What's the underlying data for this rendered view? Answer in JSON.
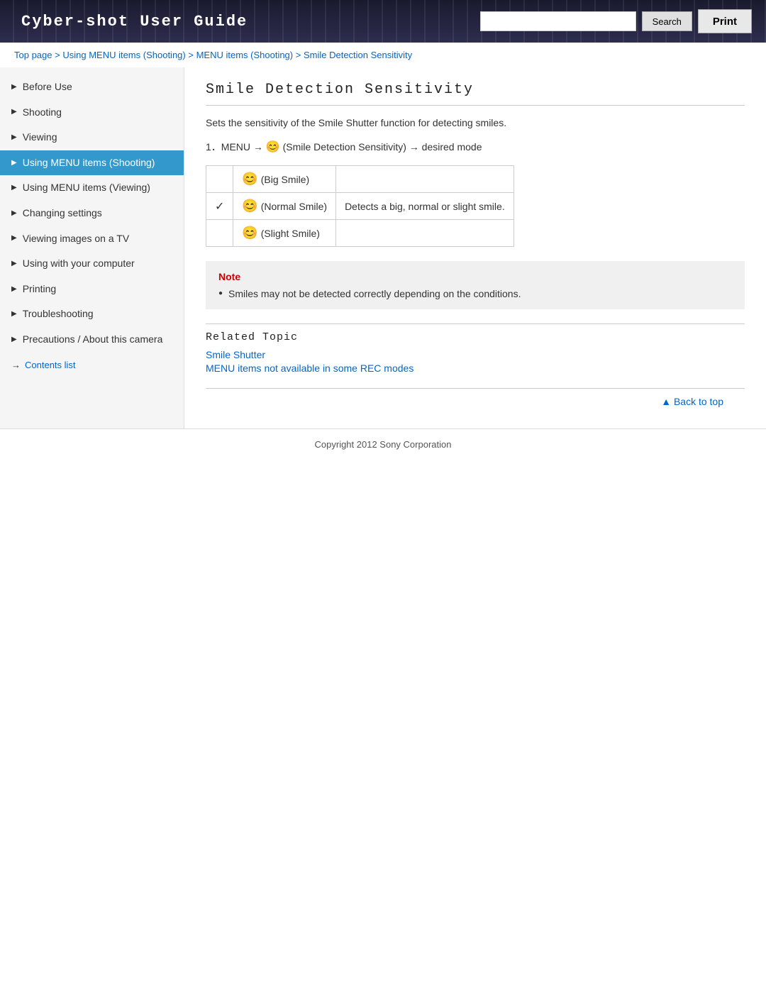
{
  "header": {
    "title": "Cyber-shot User Guide",
    "search_placeholder": "",
    "search_button_label": "Search",
    "print_button_label": "Print"
  },
  "breadcrumb": {
    "items": [
      {
        "label": "Top page",
        "href": "#"
      },
      {
        "label": "Using MENU items (Shooting)",
        "href": "#"
      },
      {
        "label": "MENU items (Shooting)",
        "href": "#"
      },
      {
        "label": "Smile Detection Sensitivity",
        "href": "#"
      }
    ],
    "separator": " > "
  },
  "sidebar": {
    "items": [
      {
        "label": "Before Use",
        "active": false
      },
      {
        "label": "Shooting",
        "active": false
      },
      {
        "label": "Viewing",
        "active": false
      },
      {
        "label": "Using MENU items (Shooting)",
        "active": true
      },
      {
        "label": "Using MENU items (Viewing)",
        "active": false
      },
      {
        "label": "Changing settings",
        "active": false
      },
      {
        "label": "Viewing images on a TV",
        "active": false
      },
      {
        "label": "Using with your computer",
        "active": false
      },
      {
        "label": "Printing",
        "active": false
      },
      {
        "label": "Troubleshooting",
        "active": false
      },
      {
        "label": "Precautions / About this camera",
        "active": false
      }
    ],
    "contents_list_label": "Contents list"
  },
  "content": {
    "page_title": "Smile Detection Sensitivity",
    "description": "Sets the sensitivity of the Smile Shutter function for detecting smiles.",
    "step": "1．MENU → ☺ (Smile Detection Sensitivity) → desired mode",
    "table": {
      "rows": [
        {
          "icon": "😊",
          "label": "(Big Smile)",
          "description": "",
          "checked": false
        },
        {
          "icon": "😊",
          "label": "(Normal Smile)",
          "description": "Detects a big, normal or slight smile.",
          "checked": true
        },
        {
          "icon": "😊",
          "label": "(Slight Smile)",
          "description": "",
          "checked": false
        }
      ]
    },
    "note": {
      "title": "Note",
      "items": [
        "Smiles may not be detected correctly depending on the conditions."
      ]
    },
    "related_topic": {
      "title": "Related Topic",
      "links": [
        {
          "label": "Smile Shutter",
          "href": "#"
        },
        {
          "label": "MENU items not available in some REC modes",
          "href": "#"
        }
      ]
    },
    "back_to_top_label": "Back to top"
  },
  "footer": {
    "copyright": "Copyright 2012 Sony Corporation"
  }
}
